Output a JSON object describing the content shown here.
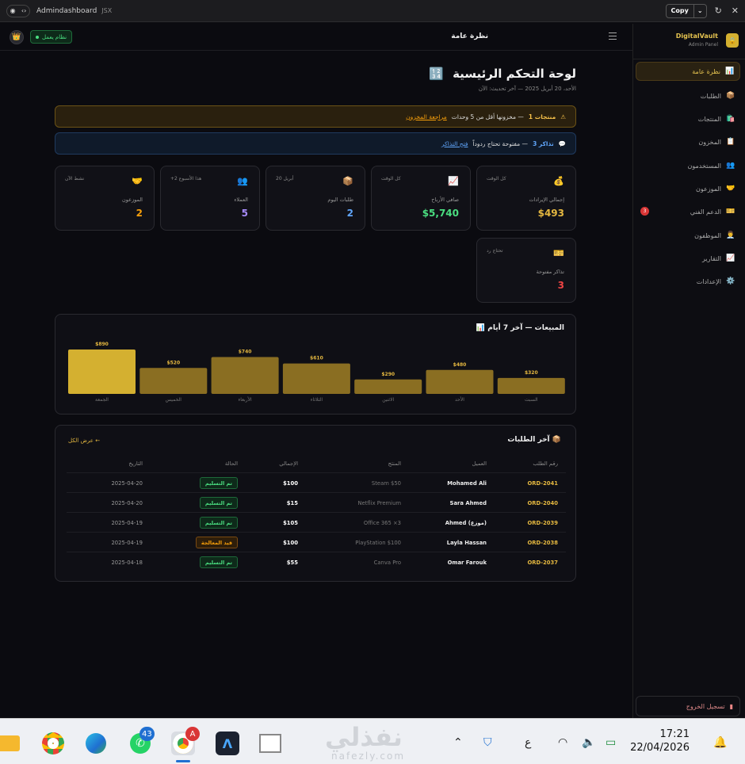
{
  "chrome": {
    "title": "Admindashboard",
    "tag": "JSX",
    "copy_label": "Copy"
  },
  "header": {
    "status": "نظام يعمل",
    "page": "نظرة عامة"
  },
  "sidebar": {
    "brand": "DigitalVault",
    "brand_sub": "Admin Panel",
    "items": [
      {
        "label": "نظرة عامة",
        "icon": "📊",
        "active": true
      },
      {
        "label": "الطلبات",
        "icon": "📦"
      },
      {
        "label": "المنتجات",
        "icon": "🛍️"
      },
      {
        "label": "المخزون",
        "icon": "📋"
      },
      {
        "label": "المستخدمون",
        "icon": "👥"
      },
      {
        "label": "الموزعون",
        "icon": "🤝"
      },
      {
        "label": "الدعم الفني",
        "icon": "🎫",
        "badge": "3"
      },
      {
        "label": "الموظفون",
        "icon": "👨‍💼"
      },
      {
        "label": "التقارير",
        "icon": "📈"
      },
      {
        "label": "الإعدادات",
        "icon": "⚙️"
      }
    ],
    "logout": "تسجيل الخروج"
  },
  "main": {
    "title": "لوحة التحكم الرئيسية",
    "title_icon": "🔢",
    "subtitle": "الأحد، 20 أبريل 2025 — آخر تحديث: الآن",
    "alert_stock": {
      "count": "1 منتجات",
      "text": "مخزونها أقل من 5 وحدات —",
      "link": "مراجعة المخزون",
      "icon": "⚠"
    },
    "alert_tickets": {
      "count": "3 تذاكر",
      "text": "مفتوحة تحتاج ردوداً —",
      "link": "فتح التذاكر",
      "icon": "💬"
    },
    "cards": [
      {
        "icon": "💰",
        "tag": "كل الوقت",
        "label": "إجمالي الإيرادات",
        "value": "$493",
        "color": "#e5b840"
      },
      {
        "icon": "📈",
        "tag": "كل الوقت",
        "label": "صافي الأرباح",
        "value": "$5,740",
        "color": "#4ade80"
      },
      {
        "icon": "📦",
        "tag": "20 أبريل",
        "label": "طلبات اليوم",
        "value": "2",
        "color": "#60a5fa"
      },
      {
        "icon": "👥",
        "tag": "+2 هذا الأسبوع",
        "label": "العملاء",
        "value": "5",
        "color": "#a78bfa"
      },
      {
        "icon": "🤝",
        "tag": "نشط الآن",
        "label": "الموزعون",
        "value": "2",
        "color": "#f59e0b"
      },
      {
        "icon": "🎫",
        "tag": "تحتاج رد",
        "label": "تذاكر مفتوحة",
        "value": "3",
        "color": "#ef4444"
      }
    ],
    "sales_title": "المبيعات — آخر 7 أيام",
    "sales_icon": "📊",
    "orders_title": "آخر الطلبات",
    "orders_icon": "📦",
    "view_all": "عرض الكل ←",
    "orders_headers": [
      "رقم الطلب",
      "العميل",
      "المنتج",
      "الإجمالي",
      "الحالة",
      "التاريخ"
    ],
    "orders": [
      {
        "id": "ORD-2041",
        "customer": "Mohamed Ali",
        "product": "Steam $50",
        "total": "$100",
        "status": "تم التسليم",
        "status_type": "done",
        "date": "2025-04-20"
      },
      {
        "id": "ORD-2040",
        "customer": "Sara Ahmed",
        "product": "Netflix Premium",
        "total": "$15",
        "status": "تم التسليم",
        "status_type": "done",
        "date": "2025-04-20"
      },
      {
        "id": "ORD-2039",
        "customer": "Ahmed (موزع)",
        "product": "Office 365 ×3",
        "total": "$105",
        "status": "تم التسليم",
        "status_type": "done",
        "date": "2025-04-19"
      },
      {
        "id": "ORD-2038",
        "customer": "Layla Hassan",
        "product": "PlayStation $100",
        "total": "$100",
        "status": "قيد المعالجة",
        "status_type": "proc",
        "date": "2025-04-19"
      },
      {
        "id": "ORD-2037",
        "customer": "Omar Farouk",
        "product": "Canva Pro",
        "total": "$55",
        "status": "تم التسليم",
        "status_type": "done",
        "date": "2025-04-18"
      }
    ]
  },
  "chart_data": {
    "type": "bar",
    "title": "المبيعات — آخر 7 أيام",
    "categories": [
      "الجمعة",
      "الخميس",
      "الأربعاء",
      "الثلاثاء",
      "الاثنين",
      "الأحد",
      "السبت"
    ],
    "values": [
      890,
      520,
      740,
      610,
      290,
      480,
      320
    ],
    "value_labels": [
      "$890",
      "$520",
      "$740",
      "$610",
      "$290",
      "$480",
      "$320"
    ],
    "highlight_index": 0,
    "colors": {
      "highlight": "#d4b030",
      "normal": "#8a6e22"
    }
  },
  "taskbar": {
    "time": "17:21",
    "date": "22/04/2026",
    "whatsapp_badge": "43",
    "chrome_badge": "A",
    "lang": "ع",
    "watermark": "نفذلي",
    "watermark_sub": "nafezly.com"
  }
}
